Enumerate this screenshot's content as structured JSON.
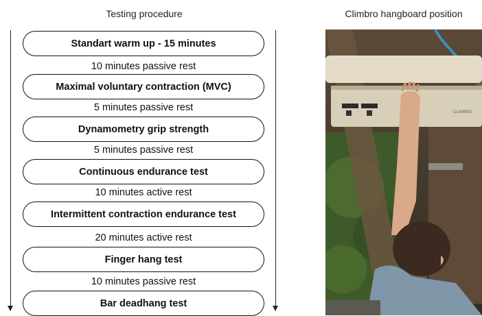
{
  "left_title": "Testing procedure",
  "right_title": "Climbro hangboard position",
  "steps": [
    "Standart warm up - 15 minutes",
    "Maximal voluntary contraction (MVC)",
    "Dynamometry grip strength",
    "Continuous endurance test",
    "Intermittent contraction endurance test",
    "Finger hang test",
    "Bar deadhang test"
  ],
  "rests": [
    "10 minutes passive rest",
    "5 minutes passive rest",
    "5 minutes passive rest",
    "10 minutes active rest",
    "20 minutes active rest",
    "10 minutes passive rest"
  ],
  "board_brand": "CLIMBRO",
  "colors": {
    "line": "#111111",
    "board": "#e4dcc8",
    "arm": "#d9a98a",
    "shirt": "#7f97a8",
    "hair": "#3a2a20",
    "foliage": "#3f5a2a",
    "wood": "#6b5640"
  }
}
